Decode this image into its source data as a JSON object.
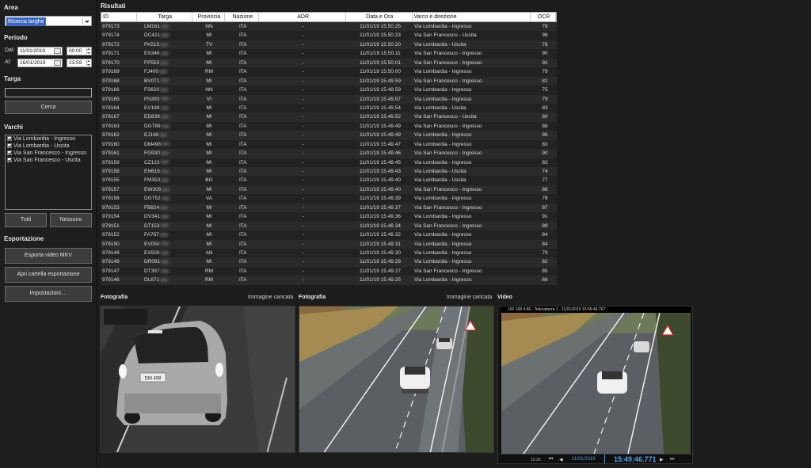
{
  "left": {
    "area_title": "Area",
    "area_value": "Ricerca targhe",
    "periodo_title": "Periodo",
    "dal_label": "Dal:",
    "al_label": "Al:",
    "dal_date": "11/01/2019",
    "dal_time": "00:00",
    "al_date": "16/01/2019",
    "al_time": "23:59",
    "targa_title": "Targa",
    "cerca_label": "Cerca",
    "varchi_title": "Varchi",
    "varchi": [
      "Via Lombardia - Ingresso",
      "Via Lombardia - Uscita",
      "Via San Francesco - Ingresso",
      "Via San Francesco - Uscita"
    ],
    "tutti_label": "Tutti",
    "nessuno_label": "Nessuno",
    "esportazione_title": "Esportazione",
    "export_mkv_label": "Esporta video MKV",
    "open_folder_label": "Apri cartella esportazione",
    "settings_label": "Impostazioni ..."
  },
  "results": {
    "title": "Risultati",
    "columns": [
      "ID",
      "Targa",
      "Provincia",
      "Nazione",
      "ADR",
      "Data e Ora",
      "Varco e direzione",
      "OCR"
    ],
    "rows": [
      [
        "979173",
        "LM161",
        "NN",
        "ITA",
        "-",
        "11/01/19 15.50.25",
        "Via Lombardia - Ingresso",
        "78"
      ],
      [
        "979174",
        "DC421",
        "MI",
        "ITA",
        "-",
        "11/01/19 15.50.23",
        "Via San Francesco - Uscita",
        "98"
      ],
      [
        "979172",
        "FK515",
        "TV",
        "ITA",
        "-",
        "11/01/19 15.50.20",
        "Via Lombardia - Uscita",
        "78"
      ],
      [
        "979171",
        "EX346",
        "MI",
        "ITA",
        "-",
        "11/01/19 15.50.11",
        "Via San Francesco - Ingresso",
        "90"
      ],
      [
        "979170",
        "FP559",
        "MI",
        "ITA",
        "-",
        "11/01/19 15.50.01",
        "Via San Francesco - Ingresso",
        "92"
      ],
      [
        "979169",
        "FJ400",
        "RM",
        "ITA",
        "-",
        "11/01/19 15.50.00",
        "Via Lombardia - Ingresso",
        "79"
      ],
      [
        "979168",
        "BV071",
        "MI",
        "ITA",
        "-",
        "11/01/19 15.49.59",
        "Via San Francesco - Ingresso",
        "82"
      ],
      [
        "979166",
        "FS620",
        "NN",
        "ITA",
        "-",
        "11/01/19 15.49.59",
        "Via Lombardia - Ingresso",
        "75"
      ],
      [
        "979165",
        "FN393",
        "VI",
        "ITA",
        "-",
        "11/01/19 15.49.57",
        "Via Lombardia - Ingresso",
        "79"
      ],
      [
        "979164",
        "EV189",
        "MI",
        "ITA",
        "-",
        "11/01/19 15.49.54",
        "Via Lombardia - Uscita",
        "83"
      ],
      [
        "979167",
        "ED839",
        "MI",
        "ITA",
        "-",
        "11/01/19 15.49.52",
        "Via San Francesco - Uscita",
        "80"
      ],
      [
        "979163",
        "DG789",
        "MI",
        "ITA",
        "-",
        "11/01/19 15.49.49",
        "Via San Francesco - Ingresso",
        "88"
      ],
      [
        "979162",
        "EJ166",
        "MI",
        "ITA",
        "-",
        "11/01/19 15.49.49",
        "Via Lombardia - Ingresso",
        "86"
      ],
      [
        "979160",
        "DM498",
        "MI",
        "ITA",
        "-",
        "11/01/19 15.49.47",
        "Via Lombardia - Ingresso",
        "83"
      ],
      [
        "979161",
        "FG930",
        "MI",
        "ITA",
        "-",
        "11/01/19 15.49.46",
        "Via San Francesco - Ingresso",
        "90"
      ],
      [
        "979159",
        "CZ123",
        "MI",
        "ITA",
        "-",
        "11/01/19 15.49.45",
        "Via Lombardia - Ingresso",
        "83"
      ],
      [
        "979158",
        "EN616",
        "MI",
        "ITA",
        "-",
        "11/01/19 15.49.43",
        "Via Lombardia - Uscita",
        "74"
      ],
      [
        "979155",
        "FM353",
        "BG",
        "ITA",
        "-",
        "11/01/19 15.49.40",
        "Via Lombardia - Uscita",
        "77"
      ],
      [
        "979157",
        "EW305",
        "MI",
        "ITA",
        "-",
        "11/01/19 15.49.40",
        "Via San Francesco - Ingresso",
        "88"
      ],
      [
        "979156",
        "DG752",
        "VA",
        "ITA",
        "-",
        "11/01/19 15.49.39",
        "Via Lombardia - Ingresso",
        "76"
      ],
      [
        "979153",
        "FB824",
        "MI",
        "ITA",
        "-",
        "11/01/19 15.49.37",
        "Via San Francesco - Ingresso",
        "87"
      ],
      [
        "979154",
        "DV341",
        "MI",
        "ITA",
        "-",
        "11/01/19 15.49.36",
        "Via Lombardia - Ingresso",
        "91"
      ],
      [
        "979151",
        "DT153",
        "MI",
        "ITA",
        "-",
        "11/01/19 15.49.34",
        "Via San Francesco - Ingresso",
        "89"
      ],
      [
        "979152",
        "FA787",
        "MI",
        "ITA",
        "-",
        "11/01/19 15.49.32",
        "Via Lombardia - Ingresso",
        "84"
      ],
      [
        "979150",
        "EV050",
        "MI",
        "ITA",
        "-",
        "11/01/19 15.49.31",
        "Via Lombardia - Ingresso",
        "84"
      ],
      [
        "979149",
        "EX500",
        "AN",
        "ITA",
        "-",
        "11/01/19 15.49.30",
        "Via Lombardia - Ingresso",
        "79"
      ],
      [
        "979148",
        "DR091",
        "MI",
        "ITA",
        "-",
        "11/01/19 15.49.28",
        "Via Lombardia - Ingresso",
        "82"
      ],
      [
        "979147",
        "DT397",
        "RM",
        "ITA",
        "-",
        "11/01/19 15.49.27",
        "Via San Francesco - Ingresso",
        "85"
      ],
      [
        "979146",
        "DL671",
        "RM",
        "ITA",
        "-",
        "11/01/19 15.49.25",
        "Via Lombardia - Ingresso",
        "68"
      ]
    ]
  },
  "bottom": {
    "foto1_title": "Fotografia",
    "foto1_status": "Immagine caricata",
    "foto1_plate": "DM 498",
    "foto2_title": "Fotografia",
    "foto2_status": "Immagine caricata",
    "video_title": "Video",
    "video_overlay": "192.168.4.66 - Telecamera 1 - 11/01/2019 15:49:46.767",
    "video_time_left": "15:30",
    "video_date": "11/01/2019",
    "video_time": "15:49:46.771"
  },
  "colors": {
    "bg": "#1c1c1c",
    "accent_blue": "#3a66c4",
    "time_blue": "#4fa3e8"
  }
}
